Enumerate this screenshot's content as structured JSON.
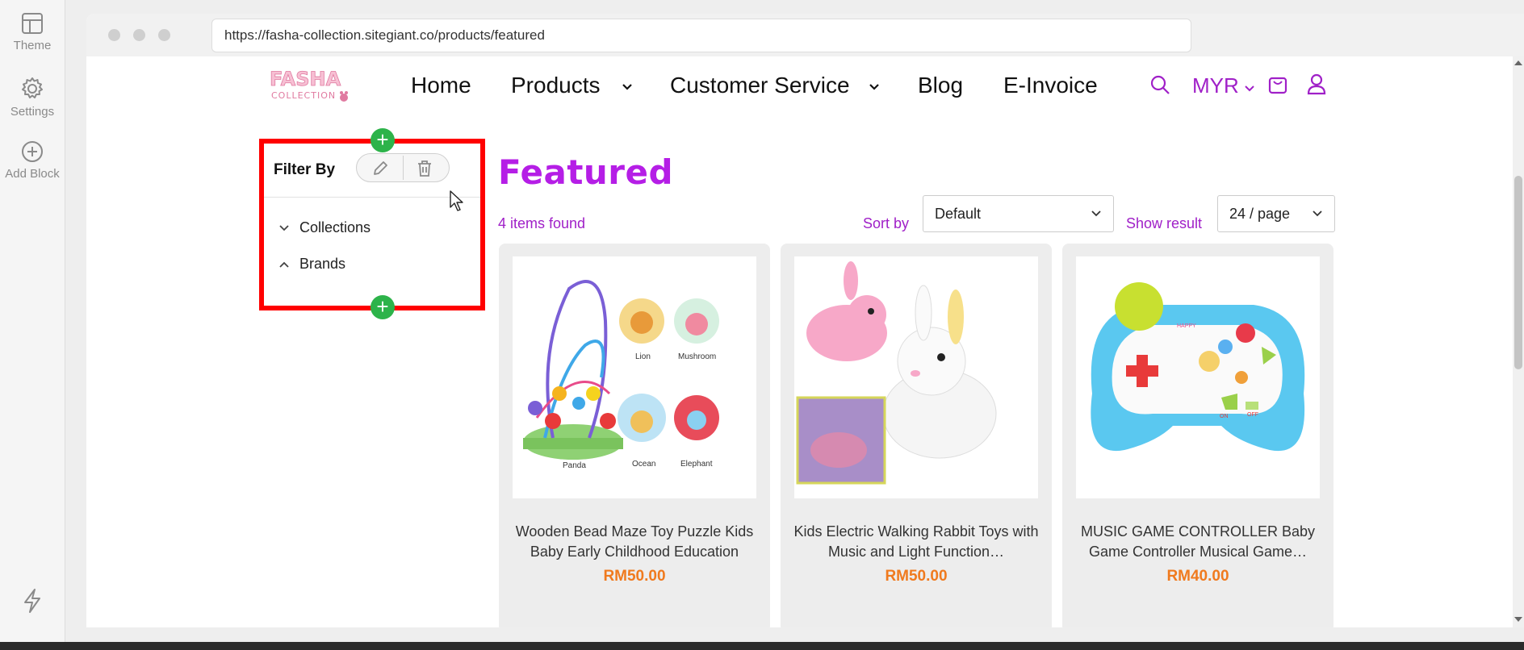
{
  "editor_rail": {
    "theme_label": "Theme",
    "settings_label": "Settings",
    "add_block_label": "Add Block"
  },
  "browser": {
    "url": "https://fasha-collection.sitegiant.co/products/featured"
  },
  "header": {
    "logo_text": "FASHA",
    "logo_subtext": "COLLECTION",
    "nav": {
      "home": "Home",
      "products": "Products",
      "customer_service": "Customer Service",
      "blog": "Blog",
      "einvoice": "E-Invoice"
    },
    "currency": "MYR"
  },
  "filter": {
    "title": "Filter By",
    "collections_label": "Collections",
    "brands_label": "Brands"
  },
  "main": {
    "title": "Featured",
    "items_found": "4 items found",
    "sort_label": "Sort by",
    "sort_value": "Default",
    "show_label": "Show result",
    "page_size": "24 / page"
  },
  "products": [
    {
      "name": "Wooden Bead Maze Toy Puzzle Kids Baby Early Childhood Education",
      "price": "RM50.00",
      "labels": [
        "Lion",
        "Mushroom",
        "Panda",
        "Ocean",
        "Elephant"
      ]
    },
    {
      "name": "Kids Electric Walking Rabbit Toys with Music and Light Function…",
      "price": "RM50.00"
    },
    {
      "name": "MUSIC GAME CONTROLLER Baby Game Controller Musical Game…",
      "price": "RM40.00",
      "labels": [
        "HAPPY",
        "ON",
        "OFF"
      ]
    }
  ],
  "colors": {
    "accent_purple": "#b51ee6",
    "price_orange": "#f07a1e",
    "selection_red": "#ff0000",
    "add_green": "#2db34a"
  },
  "icons": [
    "layout-icon",
    "gear-icon",
    "plus-circle-icon",
    "bolt-icon",
    "search-icon",
    "cart-icon",
    "user-icon",
    "pencil-icon",
    "trash-icon",
    "chevron-down-icon",
    "chevron-up-icon"
  ]
}
